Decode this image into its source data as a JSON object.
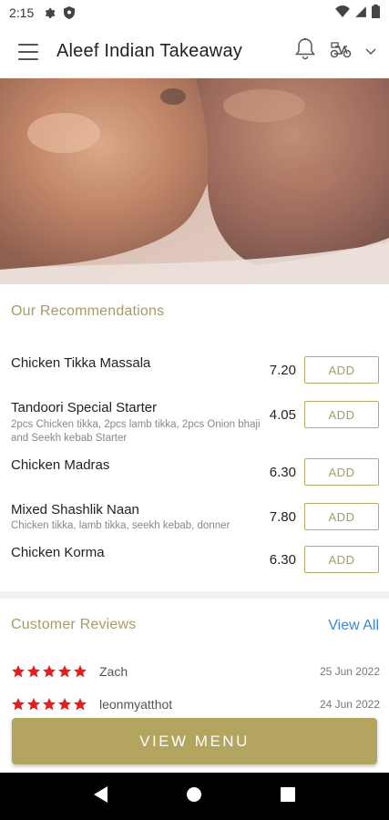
{
  "status_bar": {
    "time": "2:15"
  },
  "app_bar": {
    "title": "Aleef Indian Takeaway"
  },
  "recommendations": {
    "title": "Our Recommendations",
    "add_label": "ADD",
    "items": [
      {
        "name": "Chicken Tikka Massala",
        "desc": "",
        "price": "7.20"
      },
      {
        "name": "Tandoori Special Starter",
        "desc": "2pcs Chicken tikka, 2pcs lamb tikka, 2pcs Onion bhaji and Seekh kebab Starter",
        "price": "4.05"
      },
      {
        "name": "Chicken Madras",
        "desc": "",
        "price": "6.30"
      },
      {
        "name": "Mixed Shashlik Naan",
        "desc": "Chicken tikka, lamb tikka, seekh kebab, donner",
        "price": "7.80"
      },
      {
        "name": "Chicken Korma",
        "desc": "",
        "price": "6.30"
      }
    ]
  },
  "reviews": {
    "title": "Customer Reviews",
    "view_all": "View All",
    "items": [
      {
        "author": "Zach",
        "date": "25 Jun 2022",
        "rating": 5
      },
      {
        "author": "leonmyatthot",
        "date": "24 Jun 2022",
        "rating": 5
      }
    ]
  },
  "footer": {
    "view_menu": "VIEW MENU"
  },
  "colors": {
    "accent": "#b3a45f",
    "link": "#3f87c8",
    "star": "#e02020"
  }
}
